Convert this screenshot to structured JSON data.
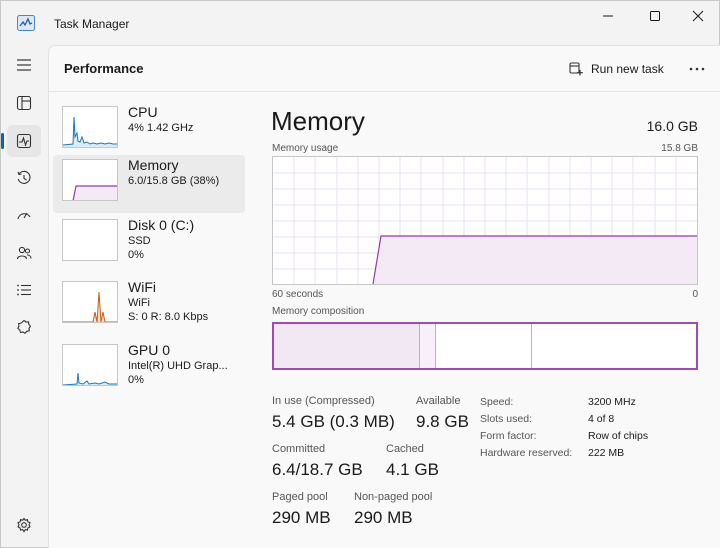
{
  "app": {
    "title": "Task Manager",
    "page_title": "Performance",
    "run_new_task_label": "Run new task"
  },
  "window_controls": [
    "minimize-icon",
    "maximize-icon",
    "close-icon"
  ],
  "nav": [
    {
      "icon": "hamburger-menu-icon"
    },
    {
      "icon": "processes-icon"
    },
    {
      "icon": "performance-icon",
      "active": true
    },
    {
      "icon": "app-history-icon"
    },
    {
      "icon": "startup-apps-icon"
    },
    {
      "icon": "users-icon"
    },
    {
      "icon": "details-icon"
    },
    {
      "icon": "services-icon"
    },
    {
      "icon": "settings-icon"
    }
  ],
  "devices": [
    {
      "name": "CPU",
      "line1": "4%  1.42 GHz",
      "line2": "",
      "line3": ""
    },
    {
      "name": "Memory",
      "line1": "6.0/15.8 GB (38%)",
      "line2": "",
      "line3": ""
    },
    {
      "name": "Disk 0 (C:)",
      "line1": "SSD",
      "line2": "0%",
      "line3": ""
    },
    {
      "name": "WiFi",
      "line1": "WiFi",
      "line2": "S: 0  R: 8.0 Kbps",
      "line3": ""
    },
    {
      "name": "GPU 0",
      "line1": "Intel(R) UHD Grap...",
      "line2": "0%",
      "line3": ""
    }
  ],
  "detail": {
    "title": "Memory",
    "total": "16.0 GB",
    "usage_label": "Memory usage",
    "usage_max": "15.8 GB",
    "time_label": "60 seconds",
    "time_end": "0",
    "composition_label": "Memory composition",
    "stats": {
      "in_use_label": "In use (Compressed)",
      "in_use_value": "5.4 GB (0.3 MB)",
      "available_label": "Available",
      "available_value": "9.8 GB",
      "committed_label": "Committed",
      "committed_value": "6.4/18.7 GB",
      "cached_label": "Cached",
      "cached_value": "4.1 GB",
      "paged_label": "Paged pool",
      "paged_value": "290 MB",
      "nonpaged_label": "Non-paged pool",
      "nonpaged_value": "290 MB"
    },
    "properties": [
      {
        "label": "Speed:",
        "value": "3200 MHz"
      },
      {
        "label": "Slots used:",
        "value": "4 of 8"
      },
      {
        "label": "Form factor:",
        "value": "Row of chips"
      },
      {
        "label": "Hardware reserved:",
        "value": "222 MB"
      }
    ]
  },
  "colors": {
    "memory_line": "#8e3fa6",
    "memory_fill": "#f3eaf5",
    "memory_border": "#a24aba",
    "cpu_line": "#1479c5",
    "wifi_line": "#c75f15",
    "accent": "#0067c0"
  }
}
